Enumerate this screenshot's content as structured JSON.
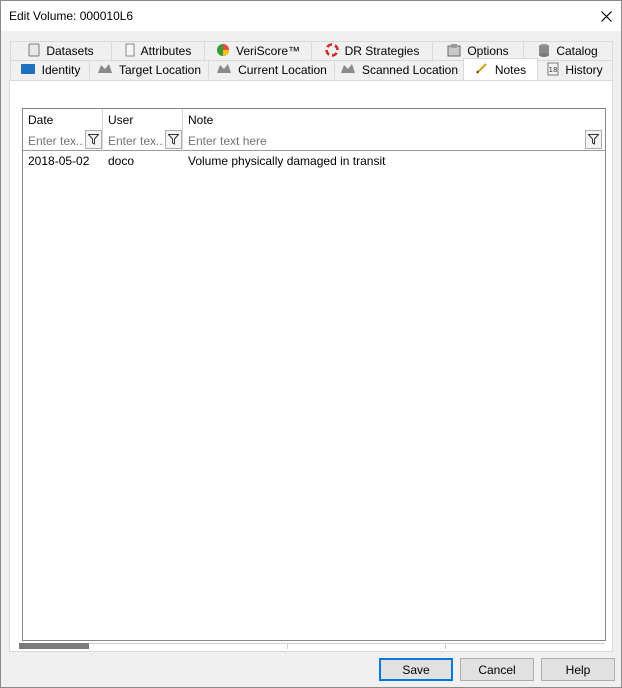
{
  "window": {
    "title": "Edit Volume: 000010L6"
  },
  "tabs_row1": [
    {
      "label": "Datasets",
      "icon": "dataset-icon"
    },
    {
      "label": "Attributes",
      "icon": "attributes-icon"
    },
    {
      "label": "VeriScore™",
      "icon": "veriscore-icon"
    },
    {
      "label": "DR Strategies",
      "icon": "lifebuoy-icon"
    },
    {
      "label": "Options",
      "icon": "options-icon"
    },
    {
      "label": "Catalog",
      "icon": "catalog-icon"
    }
  ],
  "tabs_row2": [
    {
      "label": "Identity",
      "icon": "identity-icon"
    },
    {
      "label": "Target Location",
      "icon": "target-location-icon"
    },
    {
      "label": "Current Location",
      "icon": "current-location-icon"
    },
    {
      "label": "Scanned Location",
      "icon": "scanned-location-icon"
    },
    {
      "label": "Notes",
      "icon": "notes-icon",
      "active": true
    },
    {
      "label": "History",
      "icon": "history-icon"
    }
  ],
  "grid": {
    "columns": [
      {
        "label": "Date",
        "placeholder": "Enter tex..."
      },
      {
        "label": "User",
        "placeholder": "Enter tex..."
      },
      {
        "label": "Note",
        "placeholder": "Enter text here"
      }
    ],
    "rows": [
      {
        "date": "2018-05-02",
        "user": "doco",
        "note": "Volume physically damaged in transit"
      }
    ]
  },
  "buttons": {
    "save": "Save",
    "cancel": "Cancel",
    "help": "Help"
  },
  "colors": {
    "accent": "#0078d7",
    "panel": "#f0f0f0"
  }
}
